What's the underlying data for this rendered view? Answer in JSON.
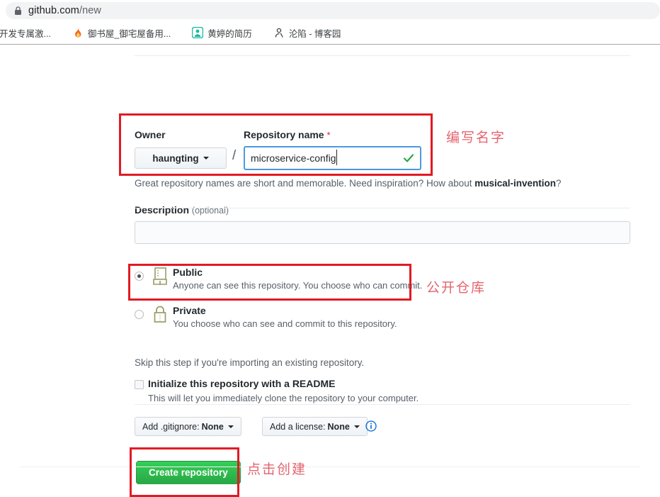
{
  "browser": {
    "lock_icon": "lock-icon",
    "url_host": "github.com",
    "url_path": "/new",
    "bookmarks": [
      {
        "label": "开发专属激...",
        "icon": "generic-bookmark-icon"
      },
      {
        "label": "御书屋_御宅屋备用...",
        "icon": "flame-icon"
      },
      {
        "label": "黄婷的简历",
        "icon": "avatar-icon"
      },
      {
        "label": "沦陷 - 博客园",
        "icon": "person-icon"
      }
    ]
  },
  "form": {
    "owner": {
      "label": "Owner",
      "selected": "haungting",
      "caret_icon": "chevron-down-icon"
    },
    "separator": "/",
    "repository_name": {
      "label": "Repository name",
      "required_mark": "*",
      "value": "microservice-config",
      "placeholder": "",
      "valid_icon": "check-icon"
    },
    "hint": {
      "prefix": "Great repository names are short and memorable. Need inspiration? How about ",
      "suggestion": "musical-invention",
      "suffix": "?"
    },
    "description": {
      "label": "Description",
      "optional": "(optional)",
      "value": "",
      "placeholder": ""
    },
    "visibility": {
      "options": [
        {
          "title": "Public",
          "description": "Anyone can see this repository. You choose who can commit.",
          "icon": "repo-book-icon",
          "selected": true
        },
        {
          "title": "Private",
          "description": "You choose who can see and commit to this repository.",
          "icon": "lock-icon",
          "selected": false
        }
      ]
    },
    "skip_note": "Skip this step if you're importing an existing repository.",
    "readme": {
      "label": "Initialize this repository with a README",
      "description": "This will let you immediately clone the repository to your computer.",
      "checked": false
    },
    "gitignore_dropdown": {
      "prefix": "Add .gitignore:",
      "value": "None",
      "caret_icon": "chevron-down-icon"
    },
    "license_dropdown": {
      "prefix": "Add a license:",
      "value": "None",
      "caret_icon": "chevron-down-icon"
    },
    "license_info_icon": "info-icon",
    "submit_label": "Create repository"
  },
  "annotations": {
    "box_color": "#e01b24",
    "text_color": "#e5646e",
    "name": "编写名字",
    "public": "公开仓库",
    "create": "点击创建"
  },
  "colors": {
    "accent_green": "#28a745",
    "link_blue": "#0366d6",
    "input_focus": "#4a9ae1",
    "required_red": "#cb2431",
    "text_primary": "#24292e",
    "text_muted": "#586069"
  }
}
